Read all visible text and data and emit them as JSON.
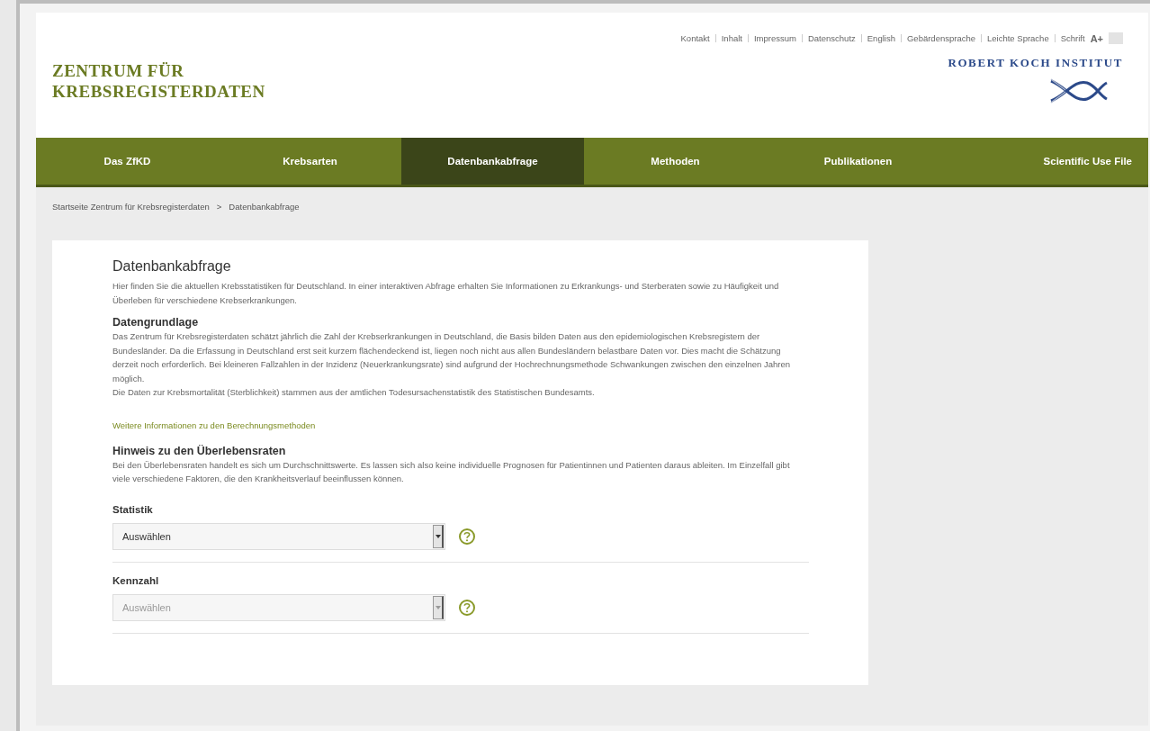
{
  "utility_links": [
    {
      "label": "Kontakt"
    },
    {
      "label": "Inhalt"
    },
    {
      "label": "Impressum"
    },
    {
      "label": "Datenschutz"
    },
    {
      "label": "English"
    },
    {
      "label": "Gebärdensprache"
    },
    {
      "label": "Leichte Sprache"
    }
  ],
  "font_size": {
    "label": "Schrift",
    "increase": "A+"
  },
  "site_title": [
    "ZENTRUM FÜR",
    "KREBSREGISTERDATEN"
  ],
  "institute_logo": {
    "text": "ROBERT KOCH INSTITUT"
  },
  "nav": [
    {
      "label": "Das ZfKD",
      "selected": false
    },
    {
      "label": "Krebsarten",
      "selected": false
    },
    {
      "label": "Datenbankabfrage",
      "selected": true
    },
    {
      "label": "Methoden",
      "selected": false
    },
    {
      "label": "Publikationen",
      "selected": false
    },
    {
      "label": "Scientific Use File",
      "selected": false
    }
  ],
  "breadcrumb": [
    {
      "label": "Startseite Zentrum für Krebsregisterdaten"
    },
    {
      "label": "Datenbankabfrage"
    }
  ],
  "breadcrumb_separator": ">",
  "page_title": "Datenbankabfrage",
  "intro": "Hier finden Sie die aktuellen Krebsstatistiken für Deutschland. In einer interaktiven Abfrage erhalten Sie Informationen zu Erkrankungs- und Sterberaten sowie zu Häufigkeit und Überleben für verschiedene Krebserkrankungen.",
  "sections": [
    {
      "heading": "Datengrundlage",
      "paragraphs": [
        "Das Zentrum für Krebsregisterdaten schätzt jährlich die Zahl der Krebserkrankungen in Deutschland, die Basis bilden Daten aus den epidemiologischen Krebsregistern der Bundesländer. Da die Erfassung in Deutschland erst seit kurzem flächendeckend ist, liegen noch nicht aus allen Bundesländern belastbare Daten vor. Dies macht die Schätzung derzeit noch erforderlich. Bei kleineren Fallzahlen in der Inzidenz (Neuerkrankungsrate) sind aufgrund der Hochrechnungsmethode Schwankungen zwischen den einzelnen Jahren möglich.",
        "Die Daten zur Krebsmortalität (Sterblichkeit) stammen aus der amtlichen Todesursachenstatistik des Statistischen Bundesamts."
      ],
      "link": "Weitere Informationen zu den Berechnungsmethoden"
    },
    {
      "heading": "Hinweis zu den Überlebensraten",
      "paragraphs": [
        "Bei den Überlebensraten handelt es sich um Durchschnittswerte. Es lassen sich also keine individuelle Prognosen für Patientinnen und Patienten daraus ableiten. Im Einzelfall gibt viele verschiedene Faktoren, die den Krankheitsverlauf beeinflussen können."
      ]
    }
  ],
  "fields": [
    {
      "label": "Statistik",
      "value": "Auswählen",
      "disabled": false
    },
    {
      "label": "Kennzahl",
      "value": "Auswählen",
      "disabled": true
    }
  ]
}
